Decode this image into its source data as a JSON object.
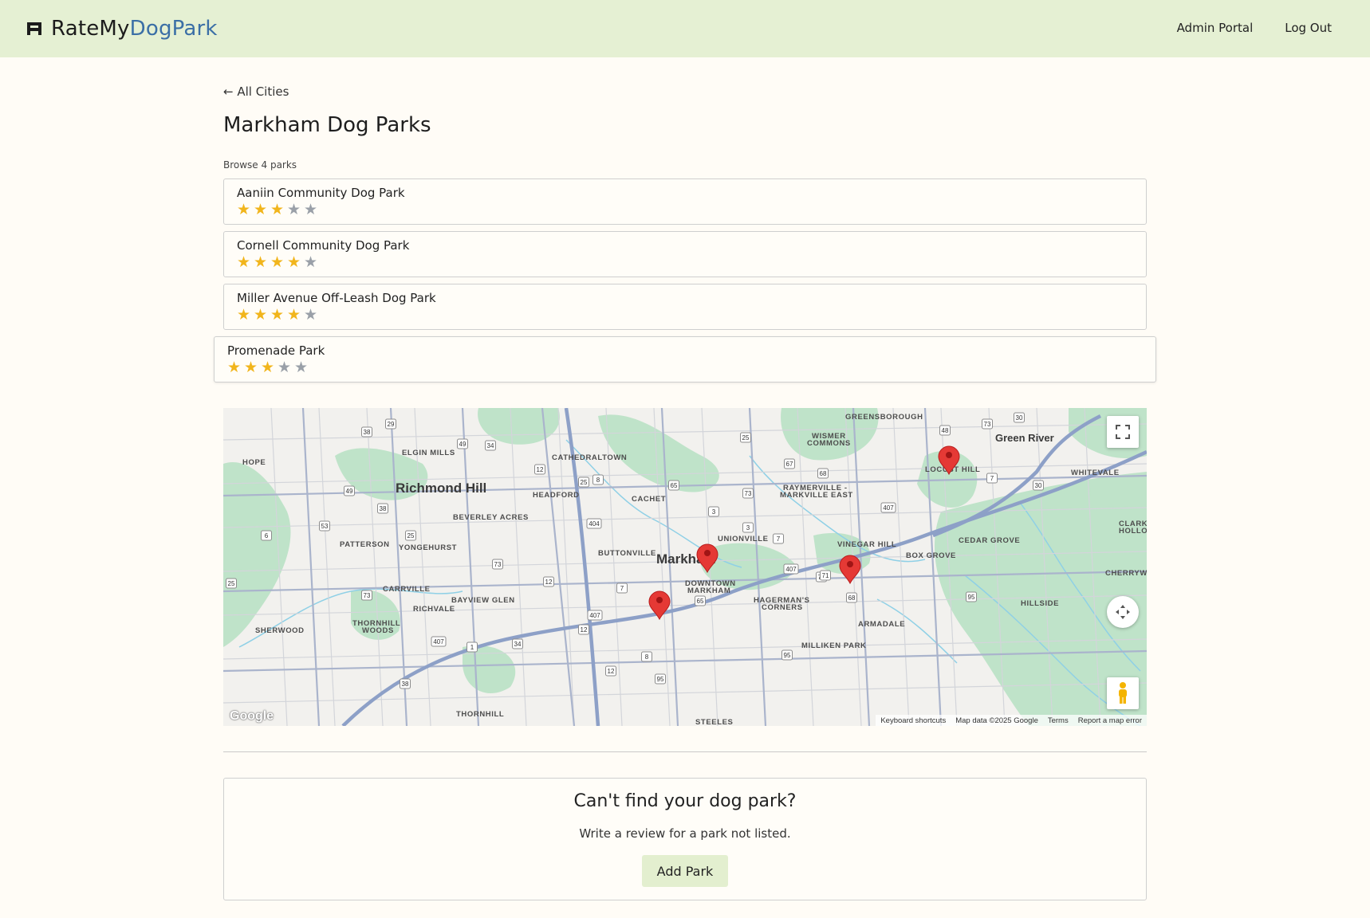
{
  "brand": {
    "name_part1": "RateMy",
    "name_part2": "DogPark",
    "icon": "dog-bed-logo-icon"
  },
  "nav": {
    "admin_label": "Admin Portal",
    "logout_label": "Log Out"
  },
  "page": {
    "back_label": "← All Cities",
    "title": "Markham Dog Parks",
    "browse_label": "Browse 4 parks"
  },
  "parks": [
    {
      "name": "Aaniin Community Dog Park",
      "rating": 3,
      "max": 5
    },
    {
      "name": "Cornell Community Dog Park",
      "rating": 4,
      "max": 5
    },
    {
      "name": "Miller Avenue Off-Leash Dog Park",
      "rating": 4,
      "max": 5
    },
    {
      "name": "Promenade Park",
      "rating": 3,
      "max": 5
    }
  ],
  "map": {
    "place_labels": {
      "richmond_hill": "Richmond Hill",
      "markham": "Markham",
      "green_river": "Green River",
      "greensborough": "GREENSBOROUGH",
      "wismer": "WISMER",
      "commons": "COMMONS",
      "locust_hill": "LOCUST HILL",
      "whitevale": "WHITEVALE",
      "elgin_mills": "ELGIN MILLS",
      "cathedraltown": "CATHEDRALTOWN",
      "hope": "HOPE",
      "headford": "HEADFORD",
      "cachet": "CACHET",
      "raymerville": "RAYMERVILLE -",
      "markville_east": "MARKVILLE EAST",
      "beverley_acres": "BEVERLEY ACRES",
      "patterson": "PATTERSON",
      "yongehurst": "YONGEHURST",
      "unionville": "UNIONVILLE",
      "buttonville": "BUTTONVILLE",
      "vinegar_hill": "VINEGAR HILL",
      "box_grove": "BOX GROVE",
      "cedar_grove": "CEDAR GROVE",
      "clark": "CLARK",
      "hollo": "HOLLO",
      "cherrywo": "CHERRYWO",
      "carrville": "CARRVILLE",
      "richvale": "RICHVALE",
      "bayview_glen": "BAYVIEW GLEN",
      "downtown": "DOWNTOWN",
      "markham_caps": "MARKHAM",
      "hagermans": "HAGERMAN'S",
      "corners": "CORNERS",
      "hillside": "HILLSIDE",
      "sherwood": "SHERWOOD",
      "thornhill": "THORNHILL",
      "woods": "WOODS",
      "armadale": "ARMADALE",
      "milliken_park": "MILLIKEN PARK",
      "thornhill_s": "THORNHILL",
      "steeles": "STEELES"
    },
    "route_shields": [
      "29",
      "38",
      "49",
      "34",
      "12",
      "25",
      "8",
      "65",
      "3",
      "25",
      "67",
      "73",
      "68",
      "48",
      "73",
      "30",
      "7",
      "30",
      "49",
      "53",
      "38",
      "25",
      "404",
      "73",
      "3",
      "7",
      "407",
      "71",
      "6",
      "73",
      "12",
      "7",
      "407",
      "68",
      "95",
      "25",
      "73",
      "407",
      "1",
      "34",
      "12",
      "65",
      "8",
      "95",
      "38",
      "12",
      "95",
      "407",
      "71"
    ],
    "footer": {
      "keyboard": "Keyboard shortcuts",
      "mapdata": "Map data ©2025 Google",
      "terms": "Terms",
      "report": "Report a map error"
    },
    "google_label": "Google",
    "marker_icon": "map-pin-icon",
    "fullscreen_icon": "fullscreen-icon",
    "camera_icon": "camera-control-icon",
    "pegman_icon": "street-view-pegman-icon"
  },
  "cta": {
    "title": "Can't find your dog park?",
    "subtitle": "Write a review for a park not listed.",
    "button_label": "Add Park"
  },
  "colors": {
    "navbar_bg": "#e5f0d3",
    "brand_accent": "#3b6fa6",
    "star_on": "#f1b51c",
    "star_off": "#9aa0a8",
    "page_bg": "#fffcf6",
    "button_bg": "#e3efcf"
  }
}
